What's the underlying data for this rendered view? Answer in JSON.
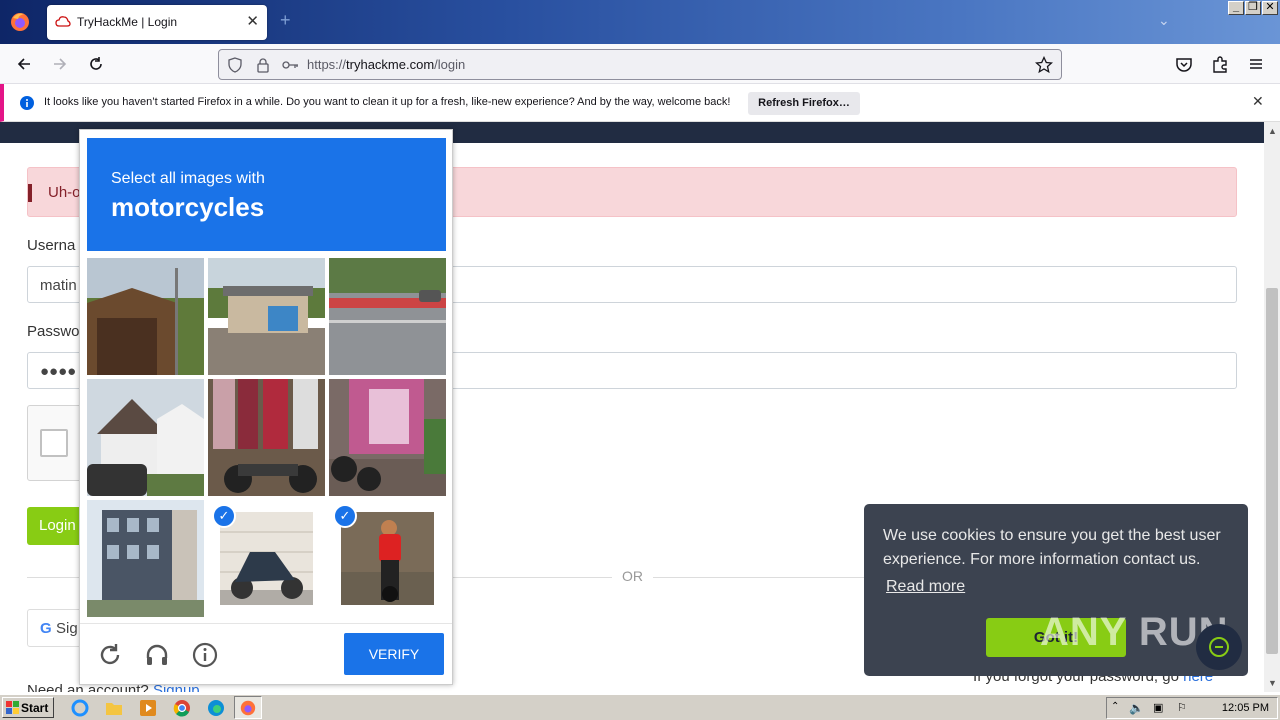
{
  "browser": {
    "tab_title": "TryHackMe | Login",
    "url_prefix": "https://",
    "url_domain": "tryhackme.com",
    "url_path": "/login"
  },
  "notification": {
    "message": "It looks like you haven’t started Firefox in a while. Do you want to clean it up for a fresh, like-new experience? And by the way, welcome back!",
    "button": "Refresh Firefox…"
  },
  "page": {
    "alert_text": "Uh-o",
    "username_label": "Userna",
    "username_value": "matin",
    "password_label": "Passwo",
    "password_value": "●●●●",
    "login_button": "Login",
    "or_text": "OR",
    "google_button": "Sig",
    "need_account": "Need an account? ",
    "signup_link": "Signup",
    "forgot_text": "If you forgot your password, go ",
    "forgot_link": "here"
  },
  "captcha": {
    "prompt": "Select all images with",
    "subject": "motorcycles",
    "verify_button": "VERIFY",
    "tiles": [
      {
        "name": "tile-wooden-shed",
        "selected": false
      },
      {
        "name": "tile-roadside-shop",
        "selected": false
      },
      {
        "name": "tile-highway-barriers",
        "selected": false
      },
      {
        "name": "tile-house-with-cars",
        "selected": false
      },
      {
        "name": "tile-clothing-rack-motorcycle",
        "selected": false
      },
      {
        "name": "tile-parked-motorcycle-shop",
        "selected": false
      },
      {
        "name": "tile-apartment-building",
        "selected": false
      },
      {
        "name": "tile-scooter-by-wall",
        "selected": true
      },
      {
        "name": "tile-rider-on-motorcycle",
        "selected": true
      }
    ]
  },
  "cookie": {
    "message": "We use cookies to ensure you get the best user experience. For more information contact us.",
    "read_more": "Read more",
    "accept": "Got it!"
  },
  "watermark": "ANY RUN",
  "taskbar": {
    "start": "Start",
    "clock": "12:05 PM"
  }
}
